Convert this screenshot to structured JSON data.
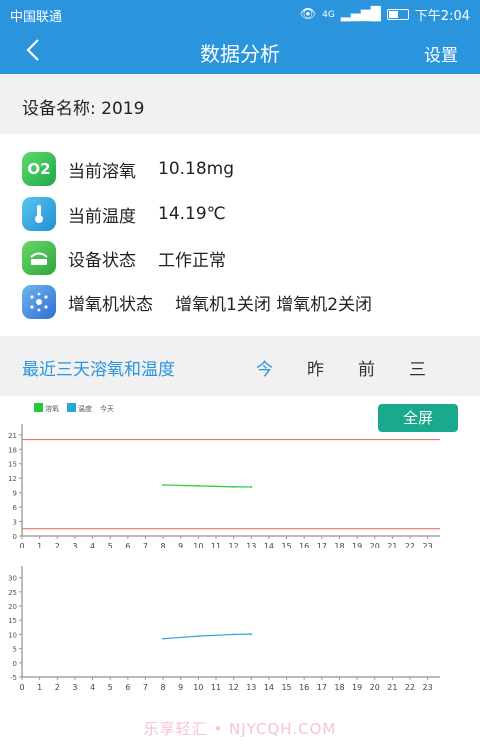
{
  "status_bar": {
    "carrier": "中国联通",
    "network": "4G",
    "time": "下午2:04"
  },
  "nav": {
    "title": "数据分析",
    "settings_label": "设置"
  },
  "device": {
    "name_label": "设备名称: 2019"
  },
  "info_rows": [
    {
      "icon": "o2-icon",
      "icon_text": "O2",
      "label": "当前溶氧",
      "value": "10.18mg"
    },
    {
      "icon": "thermometer-icon",
      "label": "当前温度",
      "value": "14.19℃"
    },
    {
      "icon": "device-icon",
      "label": "设备状态",
      "value": "工作正常"
    },
    {
      "icon": "aerator-icon",
      "label": "增氧机状态",
      "value": "增氧机1关闭 增氧机2关闭"
    }
  ],
  "chart_section": {
    "heading": "最近三天溶氧和温度",
    "tabs": [
      {
        "label": "今",
        "active": true
      },
      {
        "label": "昨"
      },
      {
        "label": "前"
      },
      {
        "label": "三"
      }
    ],
    "fullscreen_label": "全屏",
    "colors": {
      "active_tab": "#2a95dd",
      "fullscreen_bg": "#1aa98c"
    }
  },
  "chart_data": [
    {
      "type": "line",
      "legend": [
        {
          "name": "溶氧",
          "color": "#22cc33"
        },
        {
          "name": "温度",
          "color": "#2aa6d6"
        },
        {
          "name": "今天",
          "color": "#999999"
        }
      ],
      "x_ticks": [
        0,
        1,
        2,
        3,
        4,
        5,
        6,
        7,
        8,
        9,
        10,
        11,
        12,
        13,
        14,
        15,
        16,
        17,
        18,
        19,
        20,
        21,
        22,
        23
      ],
      "y_ticks": [
        0,
        3,
        6,
        9,
        12,
        15,
        18,
        21
      ],
      "ylim": [
        0,
        22
      ],
      "thresholds": [
        {
          "value": 20,
          "color": "#d9664f"
        },
        {
          "value": 1.5,
          "color": "#d9664f"
        }
      ],
      "series": [
        {
          "name": "溶氧",
          "color": "#22cc33",
          "x": [
            8,
            10,
            12,
            13
          ],
          "y": [
            10.6,
            10.4,
            10.2,
            10.18
          ]
        }
      ]
    },
    {
      "type": "line",
      "x_ticks": [
        0,
        1,
        2,
        3,
        4,
        5,
        6,
        7,
        8,
        9,
        10,
        11,
        12,
        13,
        14,
        15,
        16,
        17,
        18,
        19,
        20,
        21,
        22,
        23
      ],
      "y_ticks": [
        -5,
        0,
        5,
        10,
        15,
        20,
        25,
        30
      ],
      "ylim": [
        -5,
        32
      ],
      "series": [
        {
          "name": "温度",
          "color": "#2aa6d6",
          "x": [
            8,
            10,
            12,
            13
          ],
          "y": [
            8.5,
            9.4,
            10.0,
            10.1
          ]
        }
      ]
    }
  ],
  "watermark": "乐享轻汇 • NJYCQH.COM"
}
